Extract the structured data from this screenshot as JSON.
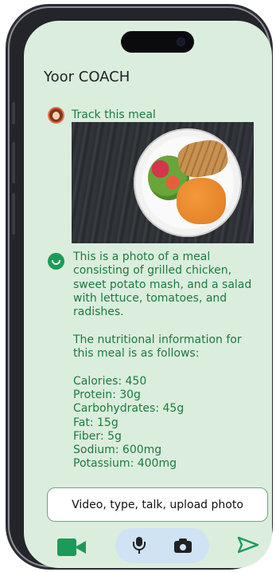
{
  "app": {
    "title": "Yoor COACH"
  },
  "chat": {
    "user_message": "Track this meal",
    "photo_alt": "Grilled chicken, sweet potato mash and salad on a plate",
    "coach_reply": "This is a photo of a meal consisting of grilled chicken, sweet potato mash, and a salad with lettuce, tomatoes, and radishes.\n\nThe nutritional information for this meal is as follows:\n\nCalories: 450\nProtein: 30g\nCarbohydrates: 45g\nFat: 15g\nFiber: 5g\nSodium: 600mg\nPotassium: 400mg"
  },
  "composer": {
    "input_text": "Video, type, talk, upload photo"
  },
  "icons": {
    "video": "video-camera-icon",
    "mic": "microphone-icon",
    "camera": "camera-icon",
    "send": "send-icon",
    "user_avatar": "user-avatar-icon",
    "coach_avatar": "coach-smile-icon"
  },
  "colors": {
    "screen_background": "#dbeede",
    "accent_green": "#1d9a5a",
    "message_text": "#1d7a3e",
    "pill_background": "#cfe3f4"
  }
}
